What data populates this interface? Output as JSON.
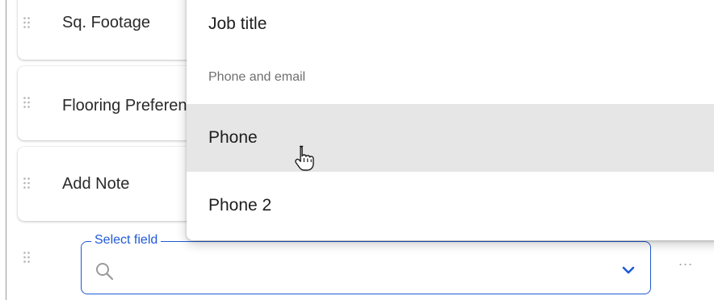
{
  "rows": [
    {
      "label": "Sq. Footage"
    },
    {
      "label": "Flooring Preference"
    },
    {
      "label": "Add Note"
    }
  ],
  "select_field": {
    "legend": "Select field",
    "search_placeholder": "",
    "accent_color": "#1f5ad6"
  },
  "row_menu": {
    "label": "..."
  },
  "dropdown": {
    "items": [
      {
        "type": "option",
        "label": "Job title"
      },
      {
        "type": "group",
        "label": "Phone and email"
      },
      {
        "type": "option",
        "label": "Phone",
        "hovered": true
      },
      {
        "type": "option",
        "label": "Phone 2"
      }
    ],
    "hover_color": "#e6e6e6"
  },
  "icons": {
    "drag": "drag-handle-icon",
    "search": "search-icon",
    "chevron": "chevron-down-icon",
    "cursor": "hand-pointer-cursor"
  }
}
